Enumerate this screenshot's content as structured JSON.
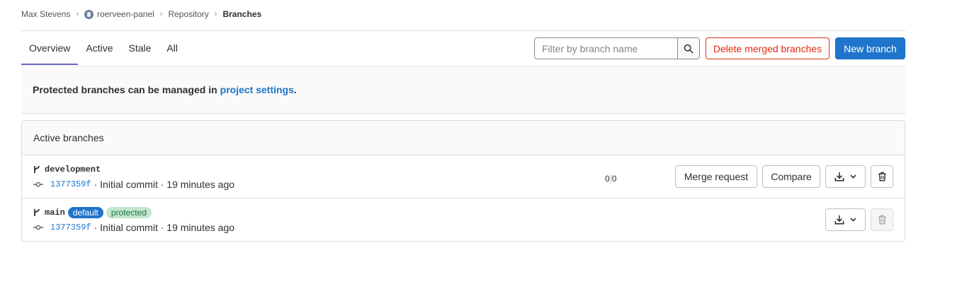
{
  "breadcrumb": {
    "user": "Max Stevens",
    "project": "roerveen-panel",
    "section": "Repository",
    "current": "Branches"
  },
  "tabs": [
    {
      "label": "Overview",
      "active": true
    },
    {
      "label": "Active",
      "active": false
    },
    {
      "label": "Stale",
      "active": false
    },
    {
      "label": "All",
      "active": false
    }
  ],
  "search": {
    "placeholder": "Filter by branch name",
    "value": "",
    "icon": "search-icon"
  },
  "actions": {
    "delete_merged_label": "Delete merged branches",
    "new_branch_label": "New branch"
  },
  "notice": {
    "text": "Protected branches can be managed in",
    "link": "project settings",
    "suffix": "."
  },
  "card": {
    "title": "Active branches"
  },
  "branches": [
    {
      "name": "development",
      "sha": "1377359f",
      "message": "· Initial commit · 19 minutes ago",
      "behind": "0",
      "ahead": "0",
      "merge_request_label": "Merge request",
      "compare_label": "Compare"
    },
    {
      "name": "main",
      "badges": [
        "default",
        "protected"
      ],
      "sha": "1377359f",
      "message": "· Initial commit · 19 minutes ago"
    }
  ],
  "colors": {
    "primary": "#1f75cb",
    "danger": "#dd2b0e",
    "tab_active": "#6666c4",
    "badge_protected_bg": "#c3e6cd"
  }
}
